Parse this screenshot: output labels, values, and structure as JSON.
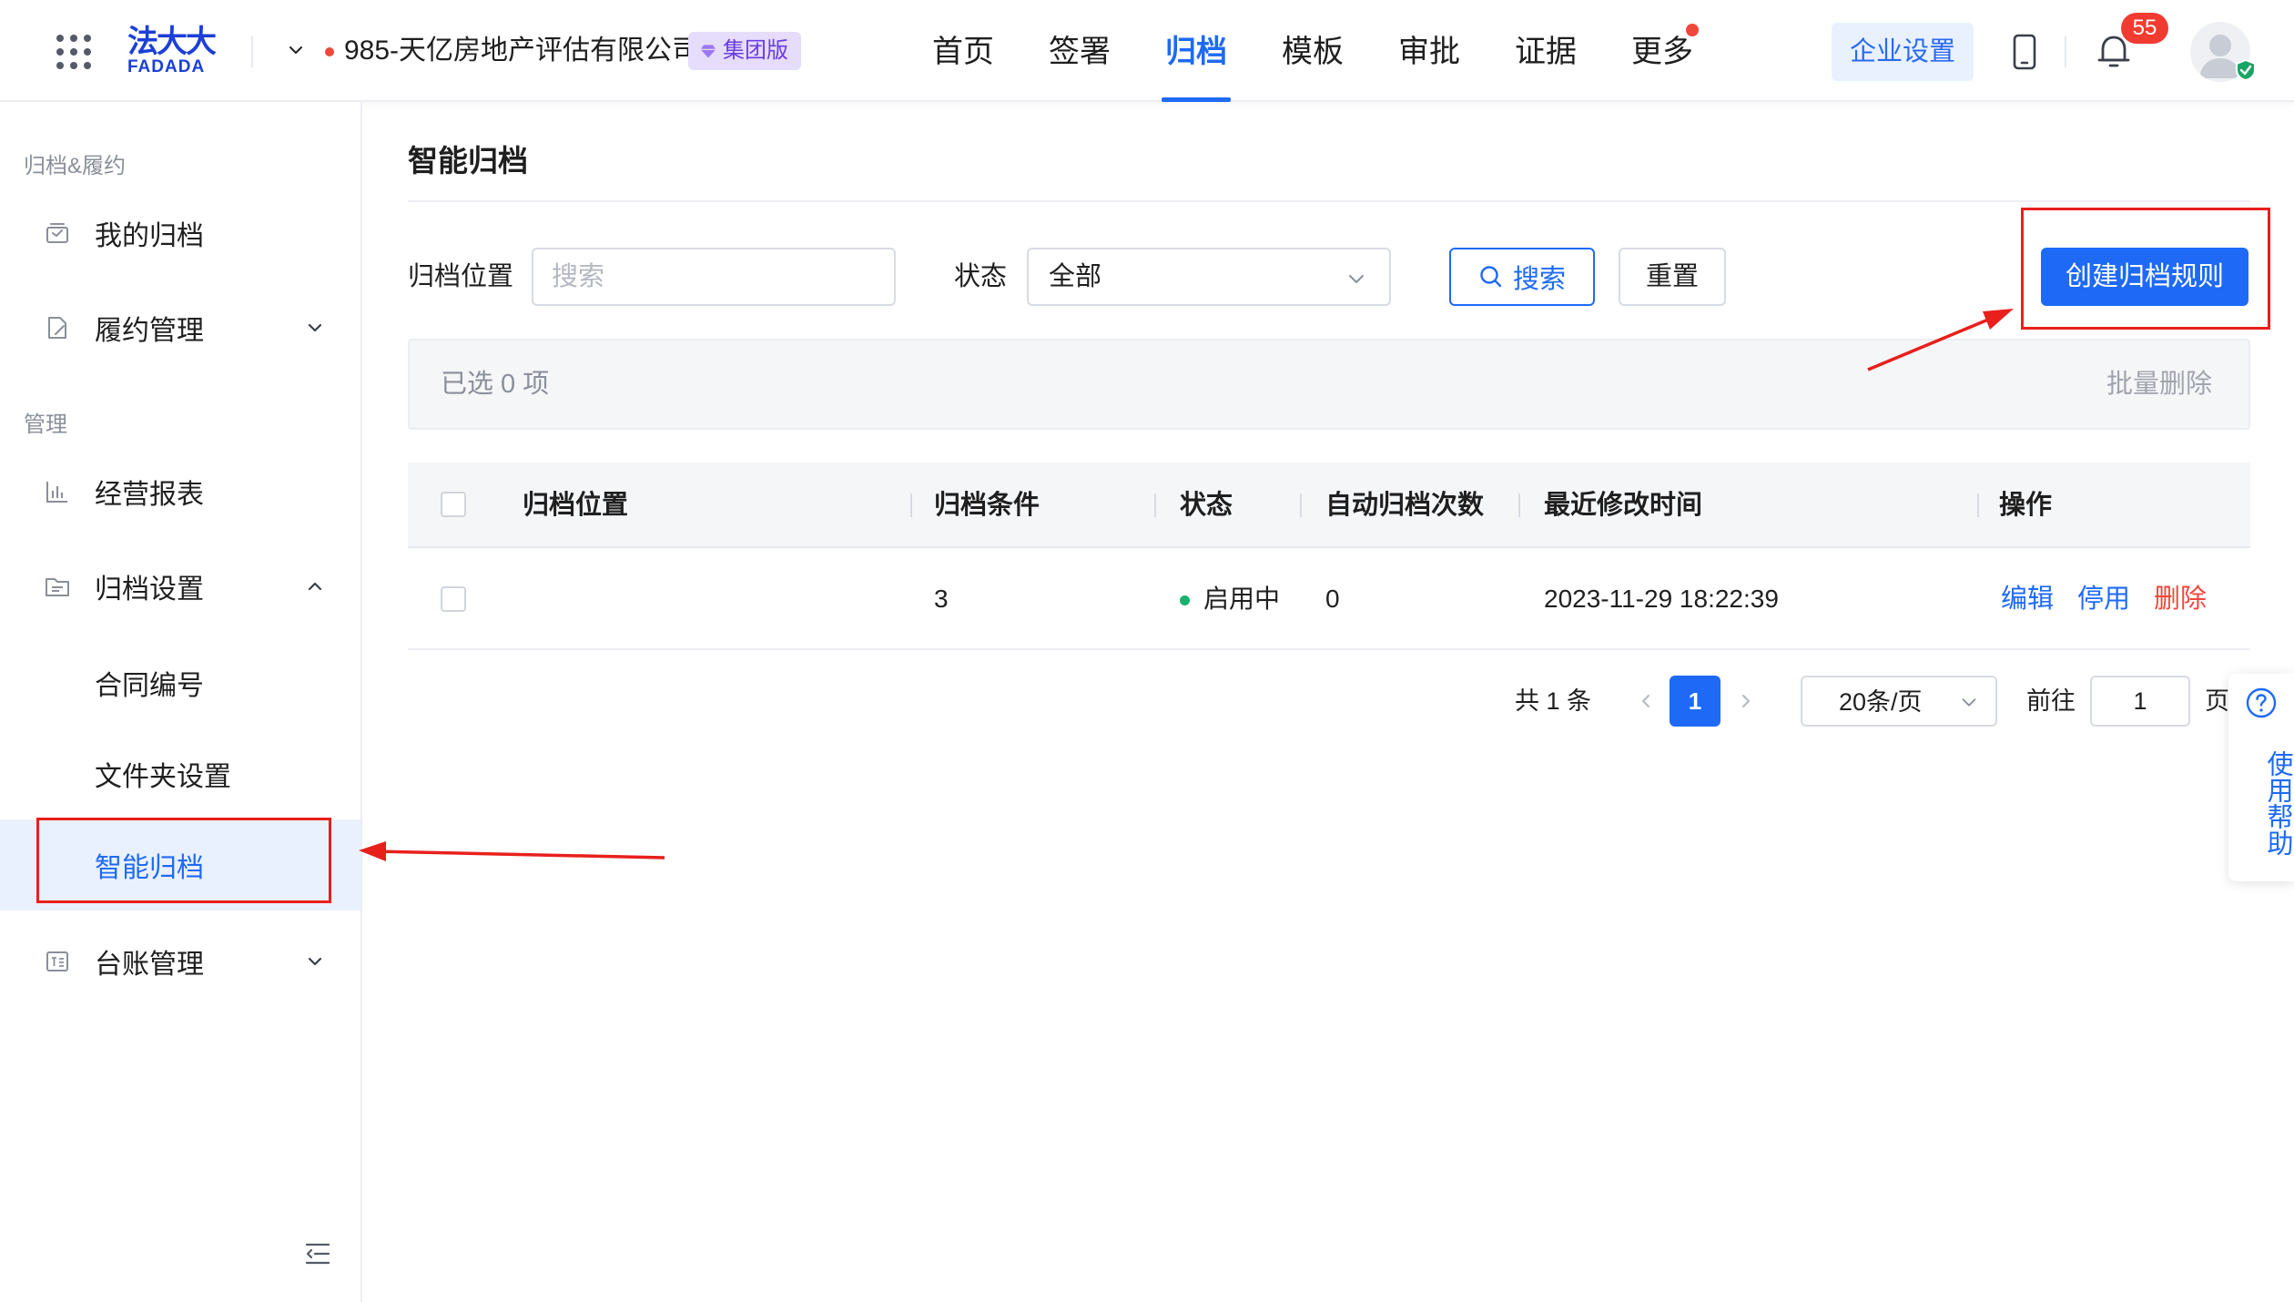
{
  "header": {
    "logo_top": "法大大",
    "logo_bottom": "FADADA",
    "company_name": "985-天亿房地产评估有限公司",
    "edition_badge": "集团版",
    "nav": [
      {
        "label": "首页",
        "active": false
      },
      {
        "label": "签署",
        "active": false
      },
      {
        "label": "归档",
        "active": true
      },
      {
        "label": "模板",
        "active": false
      },
      {
        "label": "审批",
        "active": false
      },
      {
        "label": "证据",
        "active": false
      },
      {
        "label": "更多",
        "active": false,
        "has_dot": true
      }
    ],
    "enterprise_settings": "企业设置",
    "notification_count": "55",
    "icons": [
      "apps-grid-icon",
      "chevron-down-icon",
      "diamond-icon",
      "phone-icon",
      "bell-icon",
      "avatar",
      "verified-icon"
    ]
  },
  "sidebar": {
    "group1": "归档&履约",
    "group2": "管理",
    "items": {
      "my_archive": "我的归档",
      "performance": "履约管理",
      "reports": "经营报表",
      "archive_settings": "归档设置",
      "contract_number": "合同编号",
      "folder_settings": "文件夹设置",
      "smart_archive": "智能归档",
      "ledger": "台账管理"
    },
    "active_item": "智能归档"
  },
  "main": {
    "title": "智能归档",
    "filters": {
      "location_label": "归档位置",
      "location_placeholder": "搜索",
      "location_value": "",
      "status_label": "状态",
      "status_value": "全部"
    },
    "buttons": {
      "search": "搜索",
      "reset": "重置",
      "create": "创建归档规则"
    },
    "selection": {
      "count_text": "已选 0 项",
      "batch_delete": "批量删除"
    },
    "table": {
      "columns": [
        "归档位置",
        "归档条件",
        "状态",
        "自动归档次数",
        "最近修改时间",
        "操作"
      ],
      "rows": [
        {
          "location": "",
          "conditions": "3",
          "status": "启用中",
          "auto_count": "0",
          "modified": "2023-11-29 18:22:39",
          "actions": [
            "编辑",
            "停用",
            "删除"
          ]
        }
      ]
    },
    "pagination": {
      "total": "共 1 条",
      "current_page": "1",
      "page_size": "20条/页",
      "goto_label": "前往",
      "goto_value": "1",
      "page_suffix": "页"
    },
    "help": {
      "label": "使用帮助"
    }
  },
  "colors": {
    "primary": "#1e6af7",
    "danger": "#f0463b",
    "status_active": "#17b26a",
    "annotation_red": "#e8201c",
    "badge_bg": "#e6dcfb",
    "badge_text": "#6a3ee0"
  }
}
